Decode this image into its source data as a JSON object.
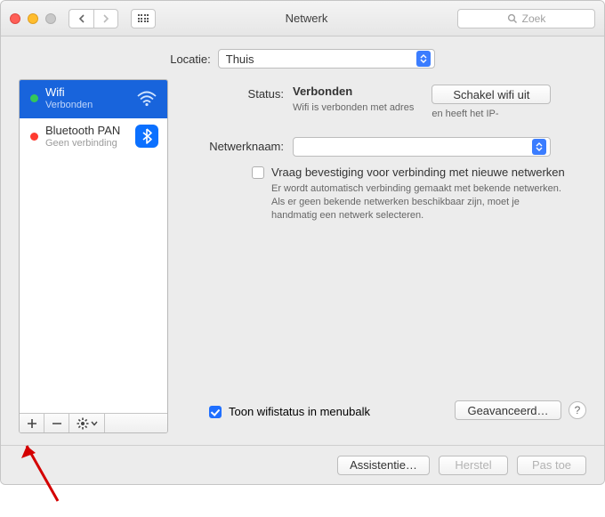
{
  "window": {
    "title": "Netwerk"
  },
  "search": {
    "placeholder": "Zoek"
  },
  "location": {
    "label": "Locatie:",
    "value": "Thuis"
  },
  "services": [
    {
      "name": "Wifi",
      "status": "Verbonden",
      "dot": "green",
      "icon": "wifi",
      "selected": true
    },
    {
      "name": "Bluetooth PAN",
      "status": "Geen verbinding",
      "dot": "red",
      "icon": "bluetooth",
      "selected": false
    }
  ],
  "detail": {
    "status_label": "Status:",
    "status_value": "Verbonden",
    "toggle_button": "Schakel wifi uit",
    "status_line1": "Wifi is verbonden met adres",
    "status_line2": "en heeft het IP-",
    "network_name_label": "Netwerknaam:",
    "network_name_value": "",
    "ask_confirm_label": "Vraag bevestiging voor verbinding met nieuwe netwerken",
    "ask_confirm_help": "Er wordt automatisch verbinding gemaakt met bekende netwerken. Als er geen bekende netwerken beschikbaar zijn, moet je handmatig een netwerk selecteren.",
    "show_in_menubar": "Toon wifistatus in menubalk",
    "advanced_button": "Geavanceerd…"
  },
  "bottom": {
    "assist": "Assistentie…",
    "revert": "Herstel",
    "apply": "Pas toe"
  }
}
